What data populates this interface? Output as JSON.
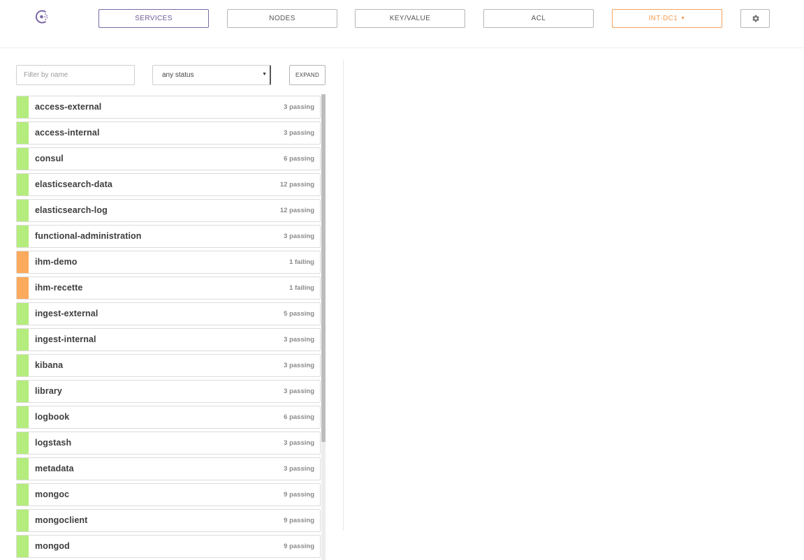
{
  "header": {
    "logo": {
      "icon": "consul-logo-icon",
      "color": "#7b68a6"
    },
    "nav": [
      {
        "label": "SERVICES",
        "active": true
      },
      {
        "label": "NODES",
        "active": false
      },
      {
        "label": "KEY/VALUE",
        "active": false
      },
      {
        "label": "ACL",
        "active": false
      }
    ],
    "datacenter": {
      "label": "INT-DC1",
      "color": "#f39a4f"
    },
    "settings_icon": "gear-icon"
  },
  "filters": {
    "name_placeholder": "Filter by name",
    "name_value": "",
    "status_selected": "any status",
    "expand_label": "EXPAND"
  },
  "colors": {
    "passing": "#b4ec7d",
    "failing": "#fbaa5e"
  },
  "services": [
    {
      "name": "access-external",
      "status": "3 passing",
      "state": "passing"
    },
    {
      "name": "access-internal",
      "status": "3 passing",
      "state": "passing"
    },
    {
      "name": "consul",
      "status": "6 passing",
      "state": "passing"
    },
    {
      "name": "elasticsearch-data",
      "status": "12 passing",
      "state": "passing"
    },
    {
      "name": "elasticsearch-log",
      "status": "12 passing",
      "state": "passing"
    },
    {
      "name": "functional-administration",
      "status": "3 passing",
      "state": "passing"
    },
    {
      "name": "ihm-demo",
      "status": "1 failing",
      "state": "failing"
    },
    {
      "name": "ihm-recette",
      "status": "1 failing",
      "state": "failing"
    },
    {
      "name": "ingest-external",
      "status": "5 passing",
      "state": "passing"
    },
    {
      "name": "ingest-internal",
      "status": "3 passing",
      "state": "passing"
    },
    {
      "name": "kibana",
      "status": "3 passing",
      "state": "passing"
    },
    {
      "name": "library",
      "status": "3 passing",
      "state": "passing"
    },
    {
      "name": "logbook",
      "status": "6 passing",
      "state": "passing"
    },
    {
      "name": "logstash",
      "status": "3 passing",
      "state": "passing"
    },
    {
      "name": "metadata",
      "status": "3 passing",
      "state": "passing"
    },
    {
      "name": "mongoc",
      "status": "9 passing",
      "state": "passing"
    },
    {
      "name": "mongoclient",
      "status": "9 passing",
      "state": "passing"
    },
    {
      "name": "mongod",
      "status": "9 passing",
      "state": "passing"
    }
  ]
}
